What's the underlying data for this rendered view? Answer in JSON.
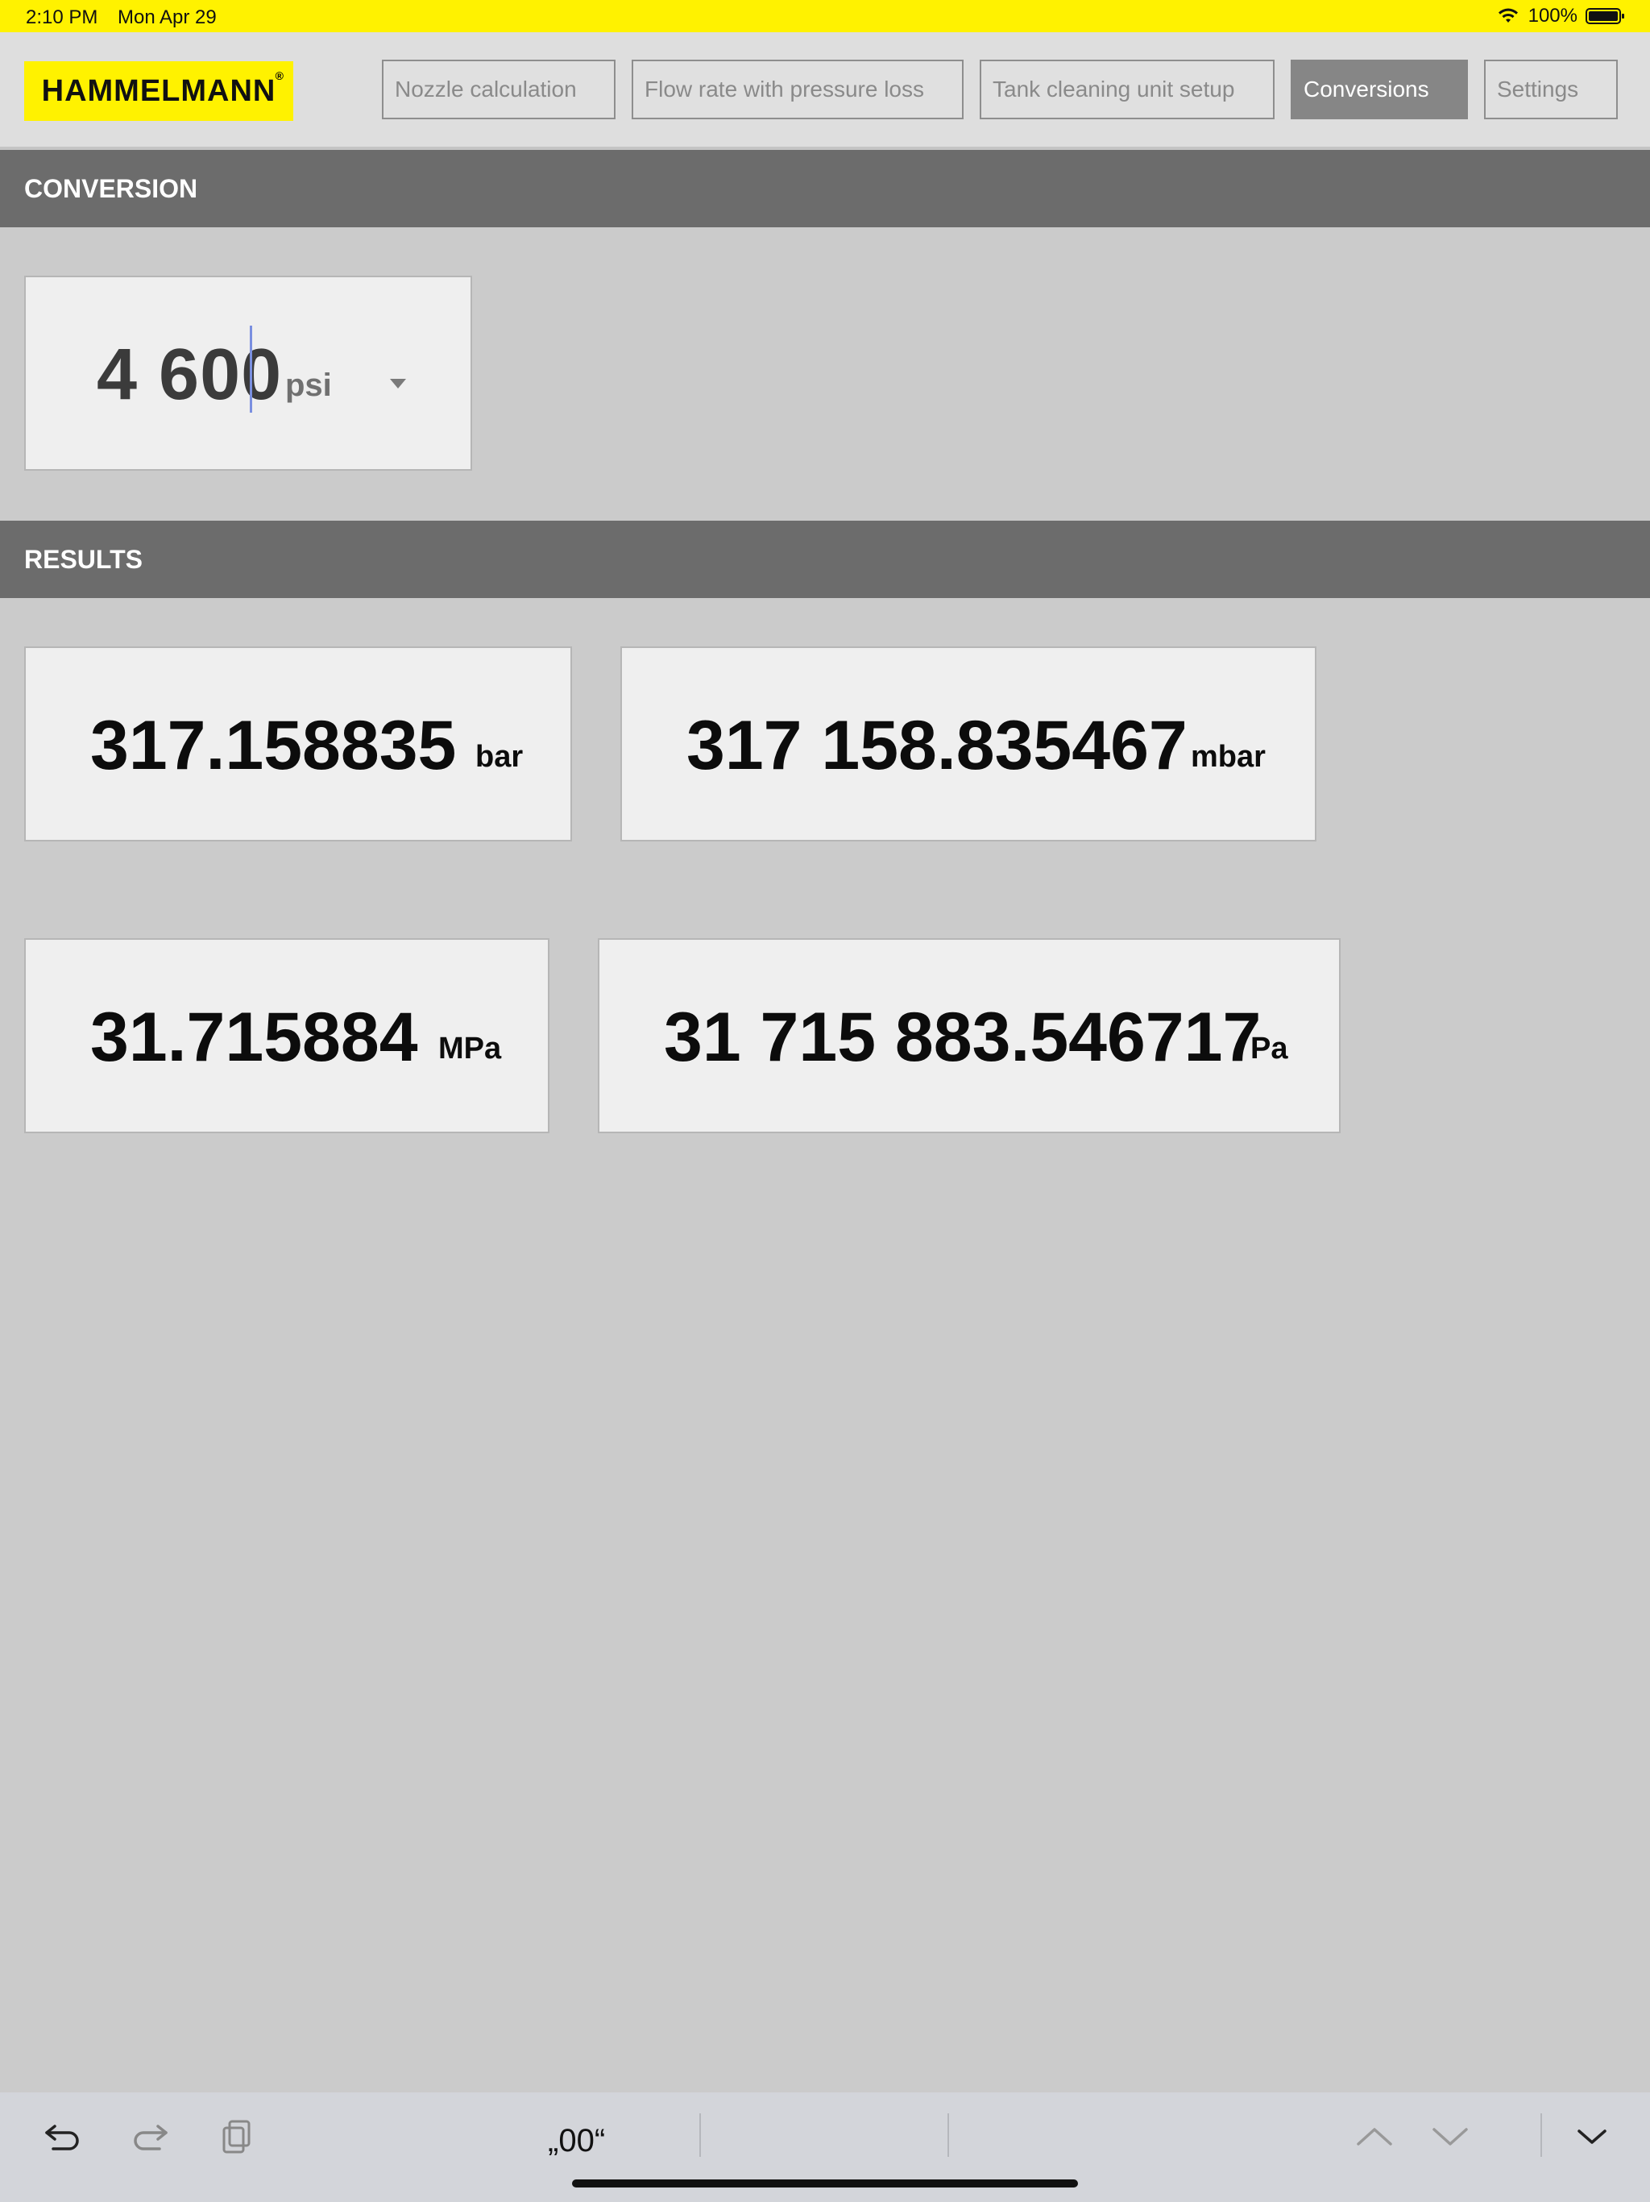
{
  "status": {
    "time": "2:10 PM",
    "date": "Mon Apr 29",
    "battery": "100%"
  },
  "header": {
    "logo": "HAMMELMANN",
    "logo_mark": "®",
    "tabs": [
      {
        "label": "Nozzle calculation",
        "active": false
      },
      {
        "label": "Flow rate with pressure loss",
        "active": false
      },
      {
        "label": "Tank cleaning unit setup",
        "active": false
      },
      {
        "label": "Conversions",
        "active": true
      },
      {
        "label": "Settings",
        "active": false
      }
    ]
  },
  "conversion": {
    "title": "CONVERSION",
    "input_value": "4 600",
    "input_unit": "psi"
  },
  "results": {
    "title": "RESULTS",
    "items": [
      {
        "value": "317.158835",
        "unit": "bar"
      },
      {
        "value": "317 158.835467",
        "unit": "mbar"
      },
      {
        "value": "31.715884",
        "unit": "MPa"
      },
      {
        "value": "31 715 883.546717",
        "unit": "Pa"
      }
    ]
  },
  "accessory": {
    "suggestion": "„00“"
  },
  "icons": [
    "wifi-icon",
    "battery-icon",
    "dropdown-arrow-icon",
    "undo-icon",
    "redo-icon",
    "paste-icon",
    "chevron-up-icon",
    "chevron-down-icon",
    "dismiss-keyboard-icon"
  ]
}
